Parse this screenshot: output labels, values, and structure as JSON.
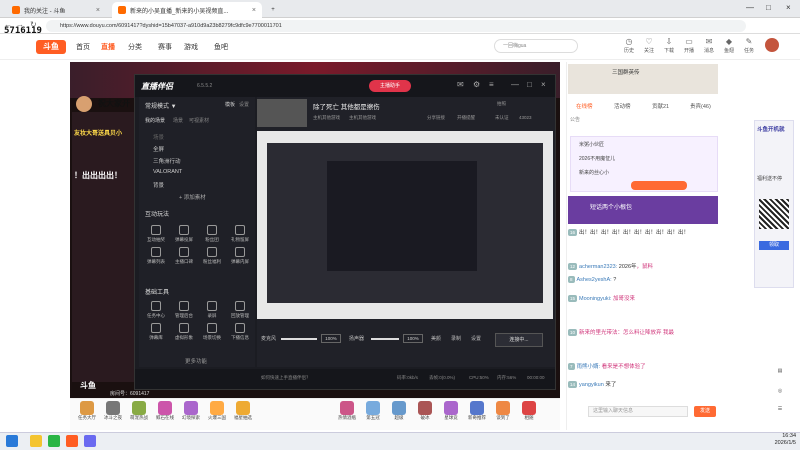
{
  "browser": {
    "tabs": [
      {
        "label": "我的关注 - 斗鱼",
        "active": false
      },
      {
        "label": "新来的小吴直播_新来的小吴视频直...",
        "active": true
      }
    ],
    "url": "https://www.douyu.com/6091417?dyshid=15b47037-a910d9a23b8279fc9dfc9e7700011701",
    "overlay_number": "5716119"
  },
  "site": {
    "logo": "斗鱼",
    "nav": [
      "首页",
      "直播",
      "分类",
      "赛事",
      "游戏",
      "鱼吧"
    ],
    "search_placeholder": "一回嗨gua",
    "header_icons": [
      {
        "label": "历史",
        "icon": "history-icon"
      },
      {
        "label": "关注",
        "icon": "heart-icon"
      },
      {
        "label": "下载",
        "icon": "download-icon"
      },
      {
        "label": "开播",
        "icon": "camera-icon"
      },
      {
        "label": "消息",
        "icon": "bell-icon"
      },
      {
        "label": "鱼翅",
        "icon": "fin-icon"
      },
      {
        "label": "任务",
        "icon": "task-icon"
      }
    ]
  },
  "room": {
    "streamer": "祝大家开",
    "video_texts": [
      "友妆大哥送具贝小",
      "！出出出出！",
      "斗鱼",
      "房间号：6091417"
    ]
  },
  "companion": {
    "title": "直播伴侣",
    "version": "6.5.5.2",
    "live_label": "主播助手",
    "left_sections": {
      "scene_title": "常规模式 ▼",
      "scene_tabs": [
        "模板",
        "设置"
      ],
      "scene_sub": [
        "我的场景",
        "场景",
        "可视素材"
      ],
      "items": [
        "场景",
        "全屏",
        "三角洲行动",
        "VALORANT",
        "背景"
      ],
      "add_source": "+ 添加素材",
      "interact_title": "互动玩法",
      "interact_items": [
        "互动抽奖",
        "弹幕投屏",
        "粉丝团",
        "礼物留屏",
        "弹幕列表",
        "主播口碑",
        "粉丝福利",
        "弹幕内屏"
      ],
      "tools_title": "基础工具",
      "tools_items": [
        "任务中心",
        "管理后台",
        "录屏",
        "回放管理",
        "弹幕库",
        "虚拟形象",
        "场景切换",
        "下播信息"
      ],
      "more": "更多功能"
    },
    "stream": {
      "title": "除了死亡 其他都是擦伤",
      "sub": [
        "主机其他游戏",
        "主机其他游戏"
      ],
      "stats": [
        "分享链接",
        "开播提醒",
        "拍照"
      ],
      "counts": [
        "直播间",
        "直播封面",
        "43023"
      ],
      "badge": "未认证"
    },
    "audio": {
      "mic": "麦克风",
      "mic_pct": "100%",
      "speaker": "扬声器",
      "speaker_pct": "100%",
      "effects": [
        "美颜",
        "录制",
        "设置"
      ]
    },
    "live_button": "连接中...",
    "status": [
      "如何快速上手直播伴侣？",
      "码率:0kb/s",
      "丢帧:0(0.0%)",
      "CPU:50%",
      "内存:56%",
      "00:00:00"
    ]
  },
  "gifts": [
    {
      "label": "任务大厅",
      "color": "#d94"
    },
    {
      "label": "冰斗之夜",
      "color": "#777"
    },
    {
      "label": "萌宠热战",
      "color": "#8a4"
    },
    {
      "label": "鲸石在线",
      "color": "#c5a"
    },
    {
      "label": "幻境探索",
      "color": "#a6c"
    },
    {
      "label": "火爆三国",
      "color": "#fa4"
    },
    {
      "label": "福星抽选",
      "color": "#ea3"
    },
    {
      "label": "热情酒瓶",
      "color": "#c58"
    },
    {
      "label": "第五冠",
      "color": "#7ad"
    },
    {
      "label": "超级",
      "color": "#69c"
    },
    {
      "label": "破冰",
      "color": "#a55"
    },
    {
      "label": "星球竞",
      "color": "#a6c"
    },
    {
      "label": "新奇推荐",
      "color": "#57c"
    },
    {
      "label": "谈到了",
      "color": "#e84"
    },
    {
      "label": "相随",
      "color": "#d44"
    }
  ],
  "right_panel": {
    "tabs": [
      "在线榜",
      "活动榜",
      "贡献21",
      "贵宾(46)"
    ],
    "notice": "公告",
    "ad_title": "三国群英传",
    "rank_rows": [
      "米粥小伙匠",
      "2026不用魔怔儿",
      "新来的丝心小"
    ],
    "chat_lines": [
      {
        "level": "16",
        "user": "",
        "text": "出！出！出！出！出！出！出！出！出！出！"
      },
      {
        "level": "12",
        "user": "acherman2323:",
        "text": "2026年",
        "extra": "，鼠料"
      },
      {
        "level": "8",
        "user": "Ashes2yeshA:",
        "text": "?"
      },
      {
        "level": "15",
        "user": "Mooningyuki:",
        "text": "加哥没来"
      },
      {
        "level": "10",
        "user": "",
        "text": "新来的里光带法：怎么料让降放弃 我最"
      },
      {
        "level": "7",
        "user": "雨熊小婿:",
        "text": "看来是不想体验了"
      },
      {
        "level": "14",
        "user": "yangyikun",
        "text": "来了"
      }
    ],
    "highlight": "短话两个小根包",
    "input_placeholder": "这里输入聊天信息",
    "send": "发送"
  },
  "ad_card": {
    "title": "斗鱼开机就",
    "line2": "福利送不停",
    "button": "领取"
  },
  "taskbar": {
    "time": "16:34",
    "date": "2026/1/5"
  }
}
